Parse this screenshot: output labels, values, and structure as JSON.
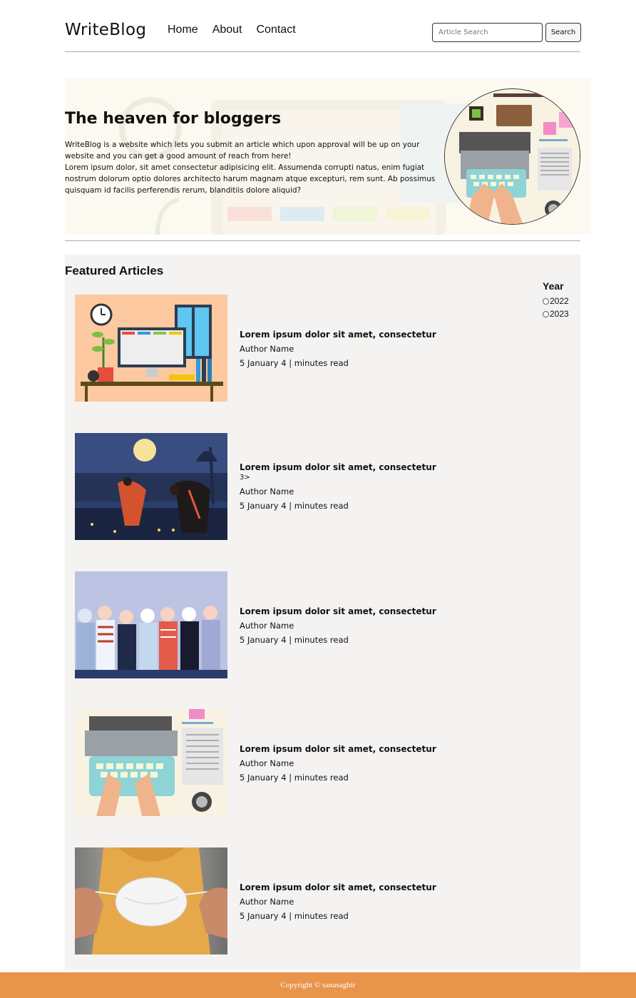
{
  "header": {
    "brand": "WriteBlog",
    "nav": [
      "Home",
      "About",
      "Contact"
    ],
    "search_placeholder": "Article Search",
    "search_button": "Search"
  },
  "hero": {
    "title": "The heaven for bloggers",
    "line1": "WriteBlog is a website which lets you submit an article which upon approval will be up on your website and you can get a good amount of reach from here!",
    "line2": "Lorem ipsum dolor, sit amet consectetur adipisicing elit. Assumenda corrupti natus, enim fugiat nostrum dolorum optio dolores architecto harum magnam atque excepturi, rem sunt. Ab possimus quisquam id facilis perferendis rerum, blanditiis dolore aliquid?"
  },
  "featured": {
    "title": "Featured Articles",
    "year_filter": {
      "title": "Year",
      "options": [
        "2022",
        "2023"
      ]
    },
    "articles": [
      {
        "title": "Lorem ipsum dolor sit amet, consectetur",
        "badge": "",
        "author": "Author Name",
        "meta": "5 January 4 | minutes read"
      },
      {
        "title": "Lorem ipsum dolor sit amet, consectetur",
        "badge": "3>",
        "author": "Author Name",
        "meta": "5 January 4 | minutes read"
      },
      {
        "title": "Lorem ipsum dolor sit amet, consectetur",
        "badge": "",
        "author": "Author Name",
        "meta": "5 January 4 | minutes read"
      },
      {
        "title": "Lorem ipsum dolor sit amet, consectetur",
        "badge": "",
        "author": "Author Name",
        "meta": "5 January 4 | minutes read"
      },
      {
        "title": "Lorem ipsum dolor sit amet, consectetur",
        "badge": "",
        "author": "Author Name",
        "meta": "5 January 4 | minutes read"
      }
    ]
  },
  "footer": {
    "copyright": "Copyright © sanasaghir"
  },
  "colors": {
    "footer": "#e8944a",
    "featured_bg": "#f5f3f2",
    "hero_bg": "#fcf9f1"
  }
}
